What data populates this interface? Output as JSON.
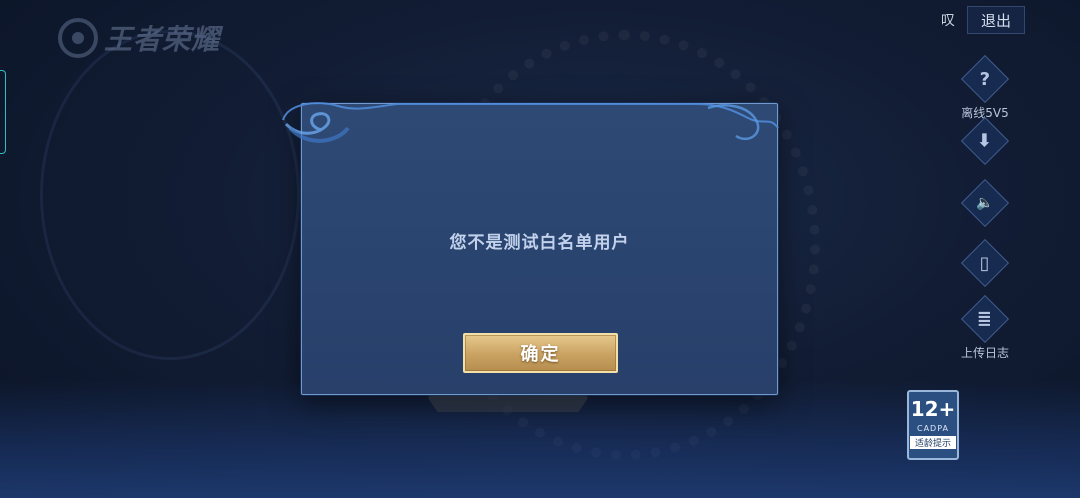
{
  "header": {
    "logo_text": "王者荣耀",
    "top_glyph": "叹",
    "exit_label": "退出"
  },
  "sidebar": {
    "items": [
      {
        "icon": "question-icon",
        "glyph": "?",
        "label": "离线5V5"
      },
      {
        "icon": "download-icon",
        "glyph": "⬇",
        "label": ""
      },
      {
        "icon": "speaker-icon",
        "glyph": "🔈",
        "label": ""
      },
      {
        "icon": "phone-icon",
        "glyph": "▯",
        "label": ""
      },
      {
        "icon": "clipboard-icon",
        "glyph": "≣",
        "label": "上传日志"
      }
    ]
  },
  "dialog": {
    "message": "您不是测试白名单用户",
    "confirm_label": "确定"
  },
  "age_rating": {
    "number": "12+",
    "org": "CADPA",
    "tip": "适龄提示"
  },
  "colors": {
    "dialog_bg": "#2e4a74",
    "dialog_border": "#6f9ad0",
    "confirm_gold": "#c9a262",
    "accent_cyan": "#2ec0c0"
  }
}
